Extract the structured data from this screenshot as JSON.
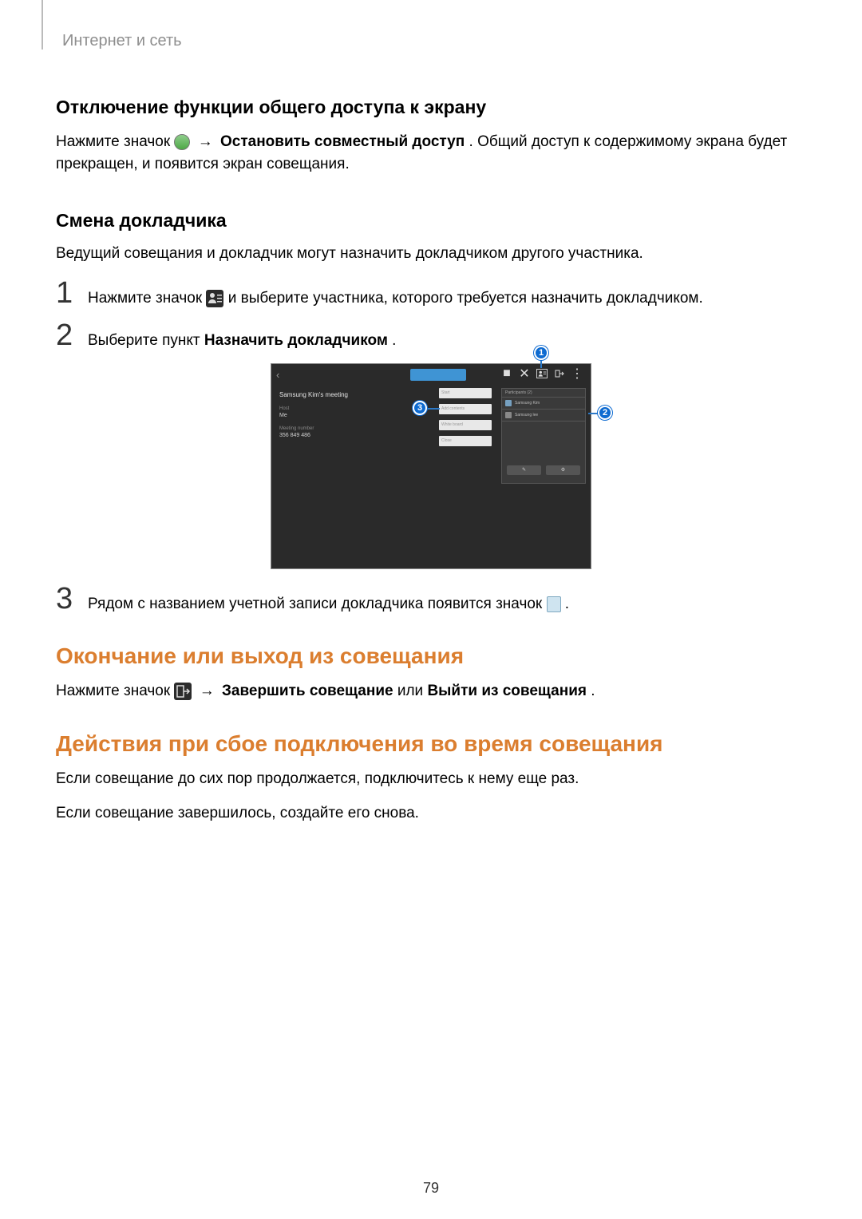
{
  "breadcrumb": "Интернет и сеть",
  "section1": {
    "title": "Отключение функции общего доступа к экрану",
    "line1_a": "Нажмите значок ",
    "line1_arrow": " → ",
    "line1_bold": "Остановить совместный доступ",
    "line1_b": ". Общий доступ к содержимому экрана будет прекращен, и появится экран совещания."
  },
  "section2": {
    "title": "Смена докладчика",
    "intro": "Ведущий совещания и докладчик могут назначить докладчиком другого участника.",
    "step1_a": "Нажмите значок ",
    "step1_b": " и выберите участника, которого требуется назначить докладчиком.",
    "step2_a": "Выберите пункт ",
    "step2_bold": "Назначить докладчиком",
    "step2_b": ".",
    "step3_a": "Рядом с названием учетной записи докладчика появится значок ",
    "step3_b": "."
  },
  "figure": {
    "meeting_title": "Samsung Kim's meeting",
    "host_label": "Host",
    "host_value": "Me",
    "meeting_no_label": "Meeting number",
    "meeting_no_value": "356 849 486",
    "docs": [
      "Start",
      "Add contents",
      "White board",
      "Close"
    ],
    "participants_header": "Participants (2)",
    "p1": "Samsung Kim",
    "p2": "Samsung lee",
    "btn_edit": "✎",
    "btn_set": "⚙",
    "callout1": "1",
    "callout2": "2",
    "callout3": "3"
  },
  "section3": {
    "title": "Окончание или выход из совещания",
    "line_a": "Нажмите значок ",
    "line_arrow": " → ",
    "line_bold1": "Завершить совещание",
    "line_mid": " или ",
    "line_bold2": "Выйти из совещания",
    "line_b": "."
  },
  "section4": {
    "title": "Действия при сбое подключения во время совещания",
    "p1": "Если совещание до сих пор продолжается, подключитесь к нему еще раз.",
    "p2": "Если совещание завершилось, создайте его снова."
  },
  "page_number": "79"
}
